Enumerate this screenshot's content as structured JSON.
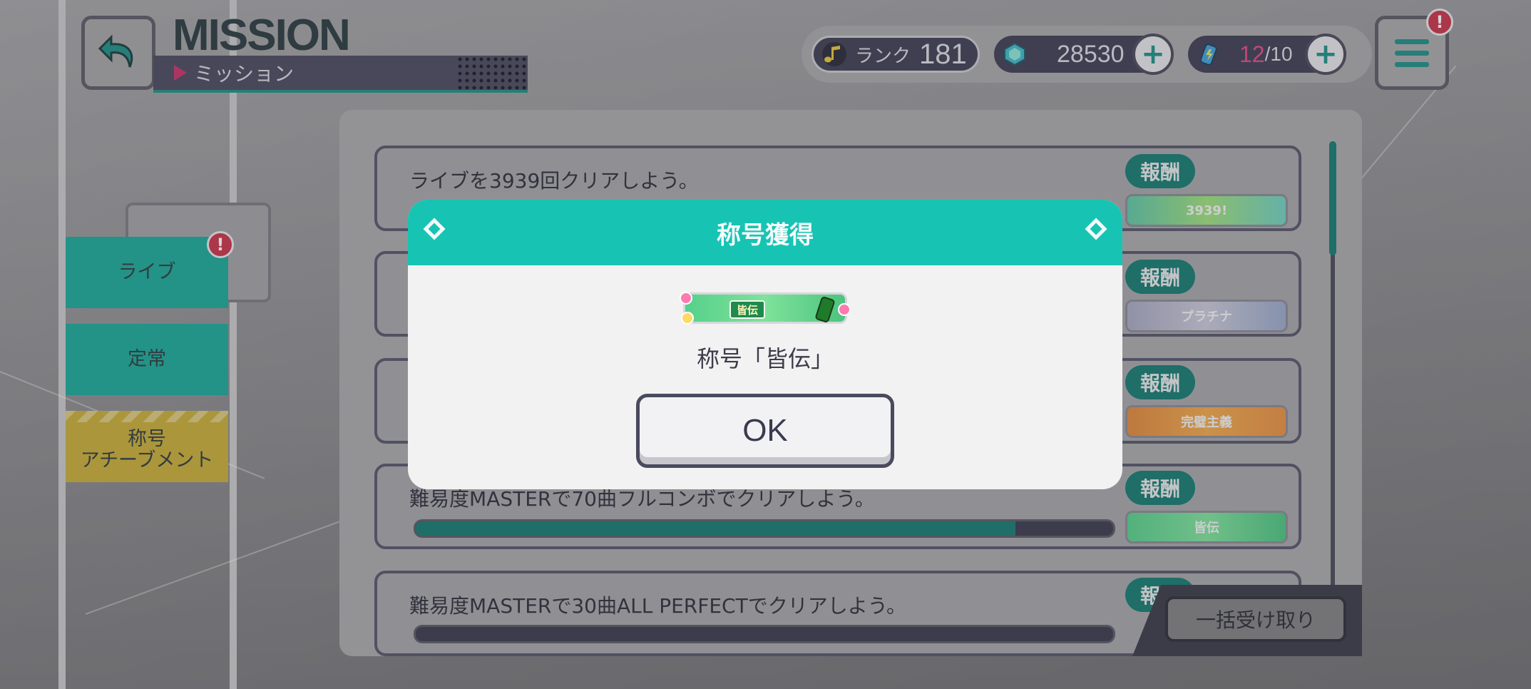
{
  "header": {
    "title_en": "MISSION",
    "title_jp": "ミッション",
    "back_icon": "back-arrow-icon",
    "menu_icon": "hamburger-menu-icon",
    "menu_alert": "!"
  },
  "status": {
    "rank_label": "ランク",
    "rank_value": "181",
    "gems": "28530",
    "energy_current": "12",
    "energy_max": "/10",
    "plus": "+"
  },
  "sidebar": {
    "tabs": [
      {
        "label": "ライブ",
        "alert": "!"
      },
      {
        "label": "定常"
      },
      {
        "label_line1": "称号",
        "label_line2": "アチーブメント"
      }
    ]
  },
  "missions": [
    {
      "text": "ライブを3939回クリアしよう。",
      "reward_label": "報酬",
      "reward_plate": "3939!"
    },
    {
      "text": "",
      "reward_label": "報酬",
      "reward_plate": "プラチナ"
    },
    {
      "text": "",
      "reward_label": "報酬",
      "reward_plate": "完璧主義"
    },
    {
      "text": "難易度MASTERで70曲フルコンボでクリアしよう。",
      "reward_label": "報酬",
      "reward_plate": "皆伝",
      "progress": 0.86
    },
    {
      "text": "難易度MASTERで30曲ALL PERFECTでクリアしよう。",
      "reward_label": "報酬",
      "progress": 0.0
    }
  ],
  "claim_all": "一括受け取り",
  "modal": {
    "title": "称号獲得",
    "plate_text": "皆伝",
    "subtitle": "称号「皆伝」",
    "ok": "OK"
  },
  "colors": {
    "accent_teal": "#17c4b4",
    "dark_teal": "#157a70",
    "alert_red": "#c9324a",
    "energy_pink": "#e04a84",
    "tab_yellow": "#c8ad38"
  }
}
